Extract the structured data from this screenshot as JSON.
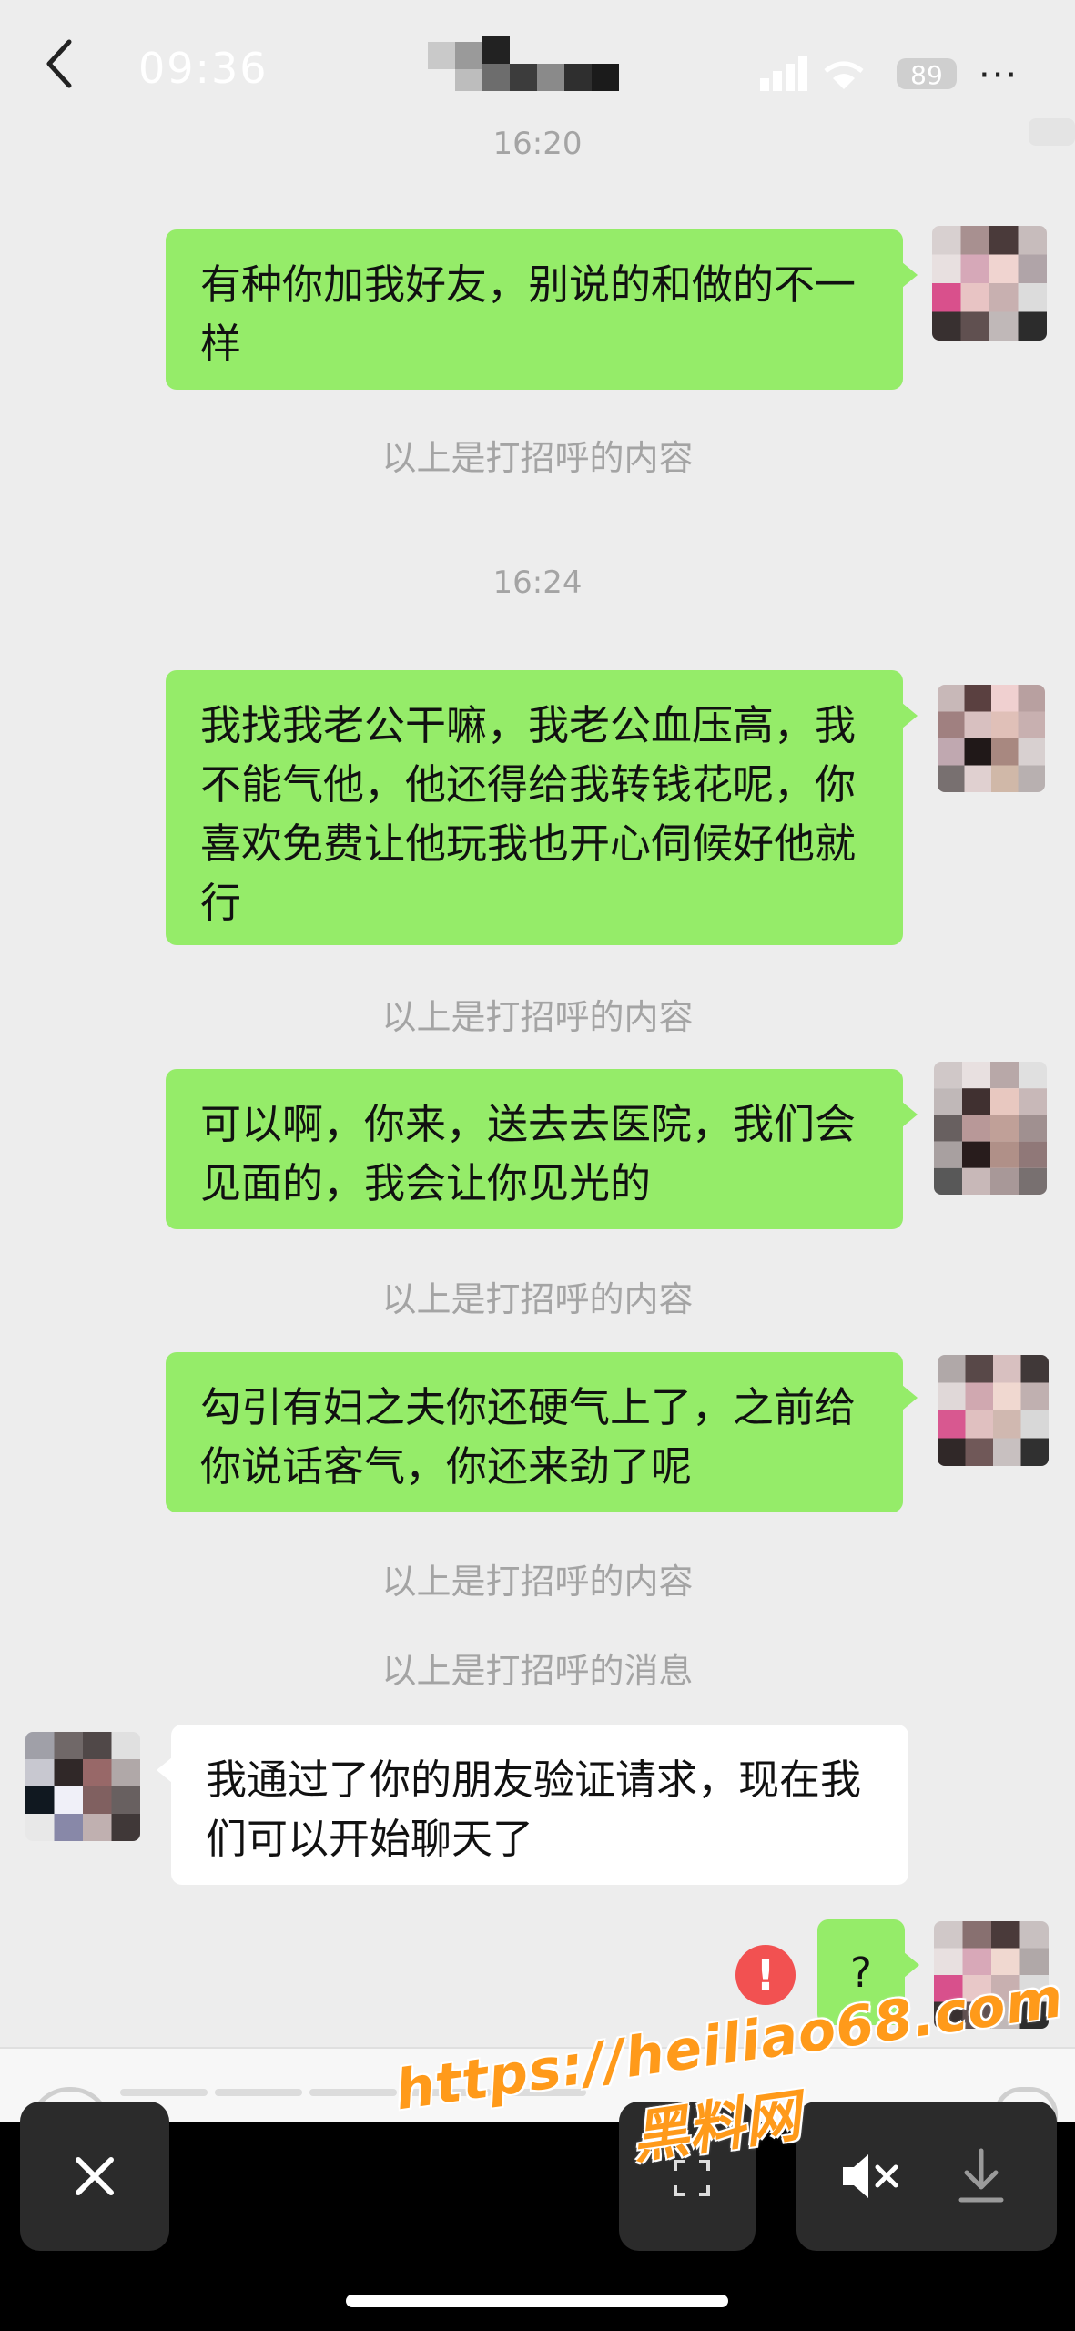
{
  "status_bar": {
    "time": "09:36",
    "battery": "89"
  },
  "header": {
    "more_label": "···"
  },
  "messages": {
    "ts1": "16:20",
    "m1": "有种你加我好友，别说的和做的不一样",
    "sys1": "以上是打招呼的内容",
    "ts2": "16:24",
    "m2": "我找我老公干嘛，我老公血压高，我不能气他，他还得给我转钱花呢，你喜欢免费让他玩我也开心伺候好他就行",
    "sys2": "以上是打招呼的内容",
    "m3": "可以啊，你来，送去去医院，我们会见面的，我会让你见光的",
    "sys3": "以上是打招呼的内容",
    "m4": "勾引有妇之夫你还硬气上了，之前给你说话客气，你还来劲了呢",
    "sys4": "以上是打招呼的内容",
    "sys5": "以上是打招呼的消息",
    "m5": "我通过了你的朋友验证请求，现在我们可以开始聊天了",
    "m6": "?",
    "fail_badge": "!"
  },
  "watermark": {
    "url": "https://heiliao68.com",
    "name": "黑料网"
  },
  "colors": {
    "outgoing": "#95ec69",
    "incoming": "#ffffff",
    "background": "#ededed",
    "error": "#f25151",
    "watermark": "#ff9a1a"
  }
}
